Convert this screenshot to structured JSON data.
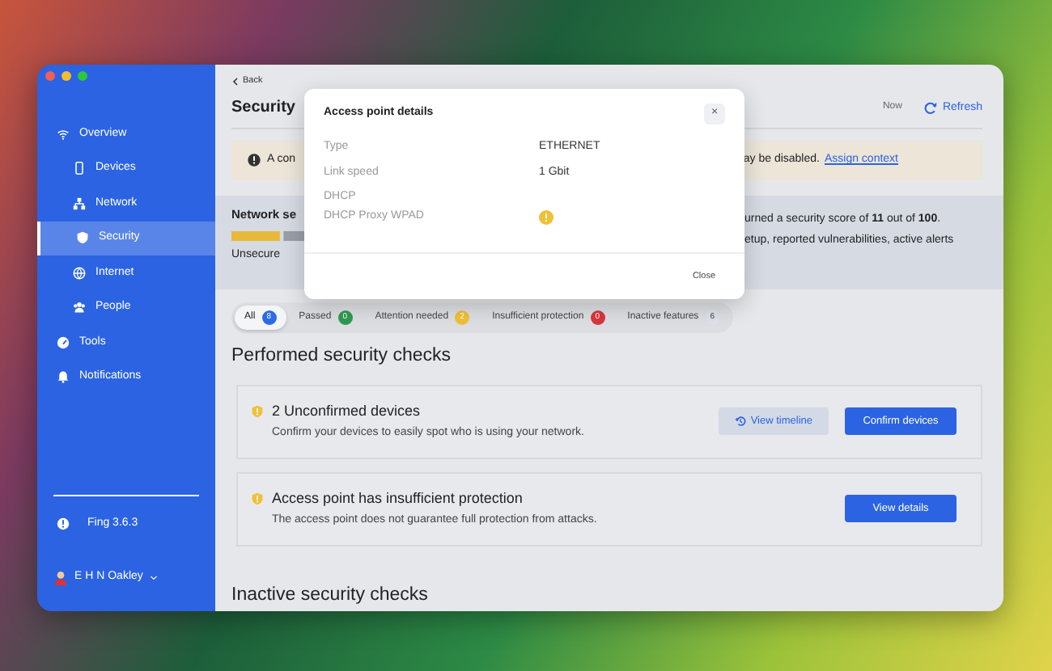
{
  "window": {
    "traffic_lights": [
      {
        "color": "#ee5f57"
      },
      {
        "color": "#f4bd30"
      },
      {
        "color": "#2bc840"
      }
    ]
  },
  "sidebar": {
    "items": [
      {
        "label": "Overview",
        "selected": false,
        "children": [
          {
            "label": "Devices",
            "selected": false
          },
          {
            "label": "Network",
            "selected": false
          },
          {
            "label": "Security",
            "selected": true
          },
          {
            "label": "Internet",
            "selected": false
          },
          {
            "label": "People",
            "selected": false
          }
        ]
      },
      {
        "label": "Tools",
        "selected": false
      },
      {
        "label": "Notifications",
        "selected": false
      }
    ],
    "version": "Fing 3.6.3",
    "user": "E H N Oakley"
  },
  "header": {
    "back": "Back",
    "title": "Security",
    "updated": "Now",
    "refresh": "Refresh"
  },
  "banner": {
    "text_start": "A con",
    "text_end": "ay be disabled.",
    "link": "Assign context"
  },
  "network_section": {
    "title": "Network se",
    "score_label": "Unsecure",
    "line_1": "urned a security score of **11** out of **100**.",
    "line_2": "etup, reported vulnerabilities, active alerts"
  },
  "filters": [
    {
      "label": "All",
      "count": "8",
      "color": "#2d6be4",
      "selected": true
    },
    {
      "label": "Passed",
      "count": "0",
      "color": "#2e9b4f",
      "selected": false
    },
    {
      "label": "Attention needed",
      "count": "2",
      "color": "#f0c038",
      "selected": false
    },
    {
      "label": "Insufficient protection",
      "count": "0",
      "color": "#d9363e",
      "selected": false
    },
    {
      "label": "Inactive features",
      "count": "6",
      "color": "#dde2ea",
      "selected": false
    }
  ],
  "performed_title": "Performed security checks",
  "checks": [
    {
      "title": "2 Unconfirmed devices",
      "description": "Confirm your devices to easily spot who is using your network.",
      "buttons": [
        {
          "label": "View timeline",
          "kind": "secondary"
        },
        {
          "label": "Confirm devices",
          "kind": "primary"
        }
      ]
    },
    {
      "title": "Access point has insufficient protection",
      "description": "The access point does not guarantee full protection from attacks.",
      "buttons": [
        {
          "label": "View details",
          "kind": "primary"
        }
      ]
    }
  ],
  "inactive_title": "Inactive security checks",
  "dialog": {
    "title": "Access point details",
    "close_icon": "×",
    "rows": [
      {
        "kind": "pair",
        "label": "Type",
        "value": "ETHERNET"
      },
      {
        "kind": "pair",
        "label": "Link speed",
        "value": "1 Gbit"
      },
      {
        "kind": "heading",
        "label": "DHCP"
      },
      {
        "kind": "status",
        "label": "DHCP Proxy WPAD"
      }
    ],
    "close": "Close"
  }
}
